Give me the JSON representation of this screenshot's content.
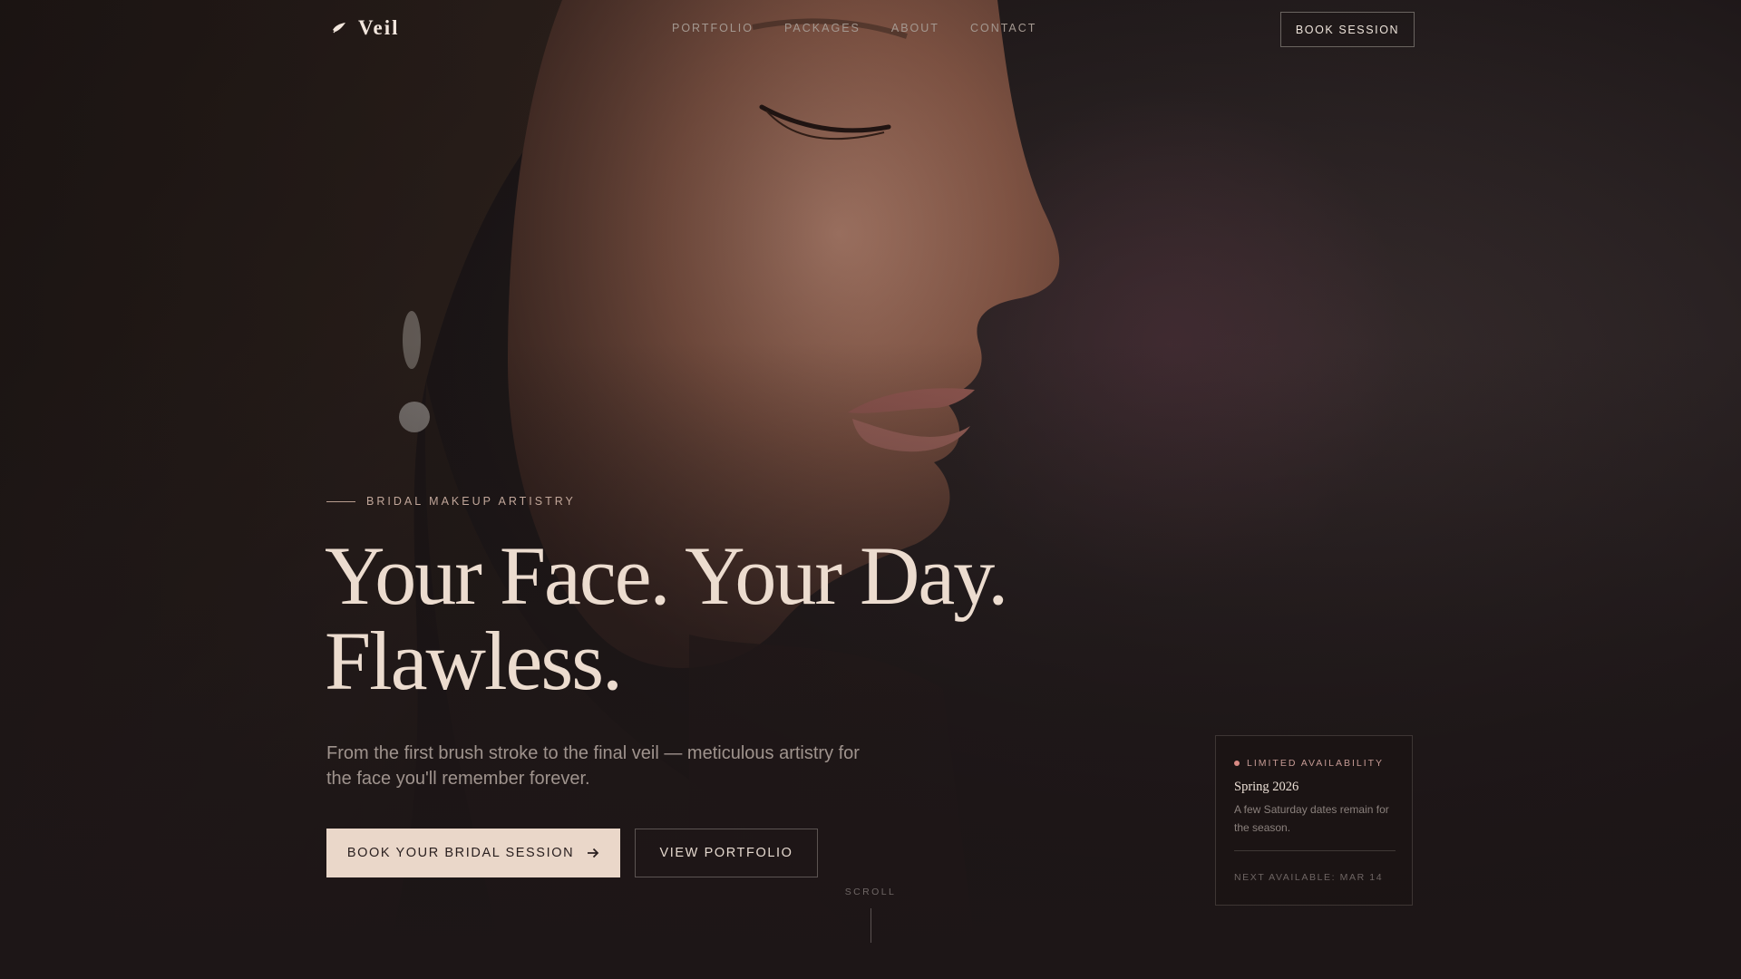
{
  "brand": {
    "name": "Veil",
    "logo_icon": "brush-leaf-icon"
  },
  "nav": {
    "links": [
      "PORTFOLIO",
      "PACKAGES",
      "ABOUT",
      "CONTACT"
    ],
    "cta": "BOOK SESSION"
  },
  "hero": {
    "eyebrow": "BRIDAL MAKEUP ARTISTRY",
    "headline": "Your Face. Your Day. Flawless.",
    "subtitle": "From the first brush stroke to the final veil — meticulous artistry for the face you'll remember forever.",
    "primary_cta": "BOOK YOUR BRIDAL SESSION",
    "primary_cta_icon": "arrow-right-icon",
    "secondary_cta": "VIEW PORTFOLIO",
    "scroll_label": "SCROLL"
  },
  "availability": {
    "badge": "LIMITED AVAILABILITY",
    "title": "Spring 2026",
    "body": "A few Saturday dates remain for the season.",
    "next": "NEXT AVAILABLE: MAR 14"
  },
  "colors": {
    "background": "#1d1617",
    "accent": "#ead7c9",
    "headline": "#ecdccf",
    "badge_dot": "#d98a84"
  }
}
